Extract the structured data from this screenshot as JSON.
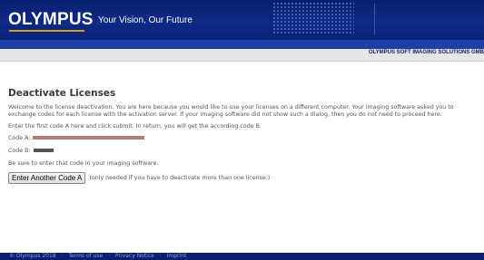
{
  "header": {
    "logo": "OLYMPUS",
    "tagline": "Your Vision, Our Future",
    "company": "OLYMPUS SOFT IMAGING SOLUTIONS GMB"
  },
  "main": {
    "title": "Deactivate Licenses",
    "intro": "Welcome to the license deactivation. You are here because you would like to use your licenses on a different computer. Your imaging software asked you to exchange codes for each license with the activation server. If your imaging software did not show such a dialog, then you do not need to proceed here.",
    "instruction": "Enter the first code A here and click submit. In return, you will get the according code B.",
    "code_a_label": "Code A:",
    "code_b_label": "Code B:",
    "reminder": "Be sure to enter that code in your imaging software.",
    "button_label": "Enter Another Code A",
    "button_note": "(only needed if you have to deactivate more than one license.)"
  },
  "footer": {
    "copyright": "© Olympus 2018",
    "sep": "·",
    "terms": "Terms of use",
    "privacy": "Privacy Notice",
    "imprint": "Imprint"
  },
  "colors": {
    "header_bg": "#0c2a86",
    "accent_gold": "#d4a21e",
    "code_a_mask": "#b07a78",
    "code_b_mask": "#555555"
  }
}
